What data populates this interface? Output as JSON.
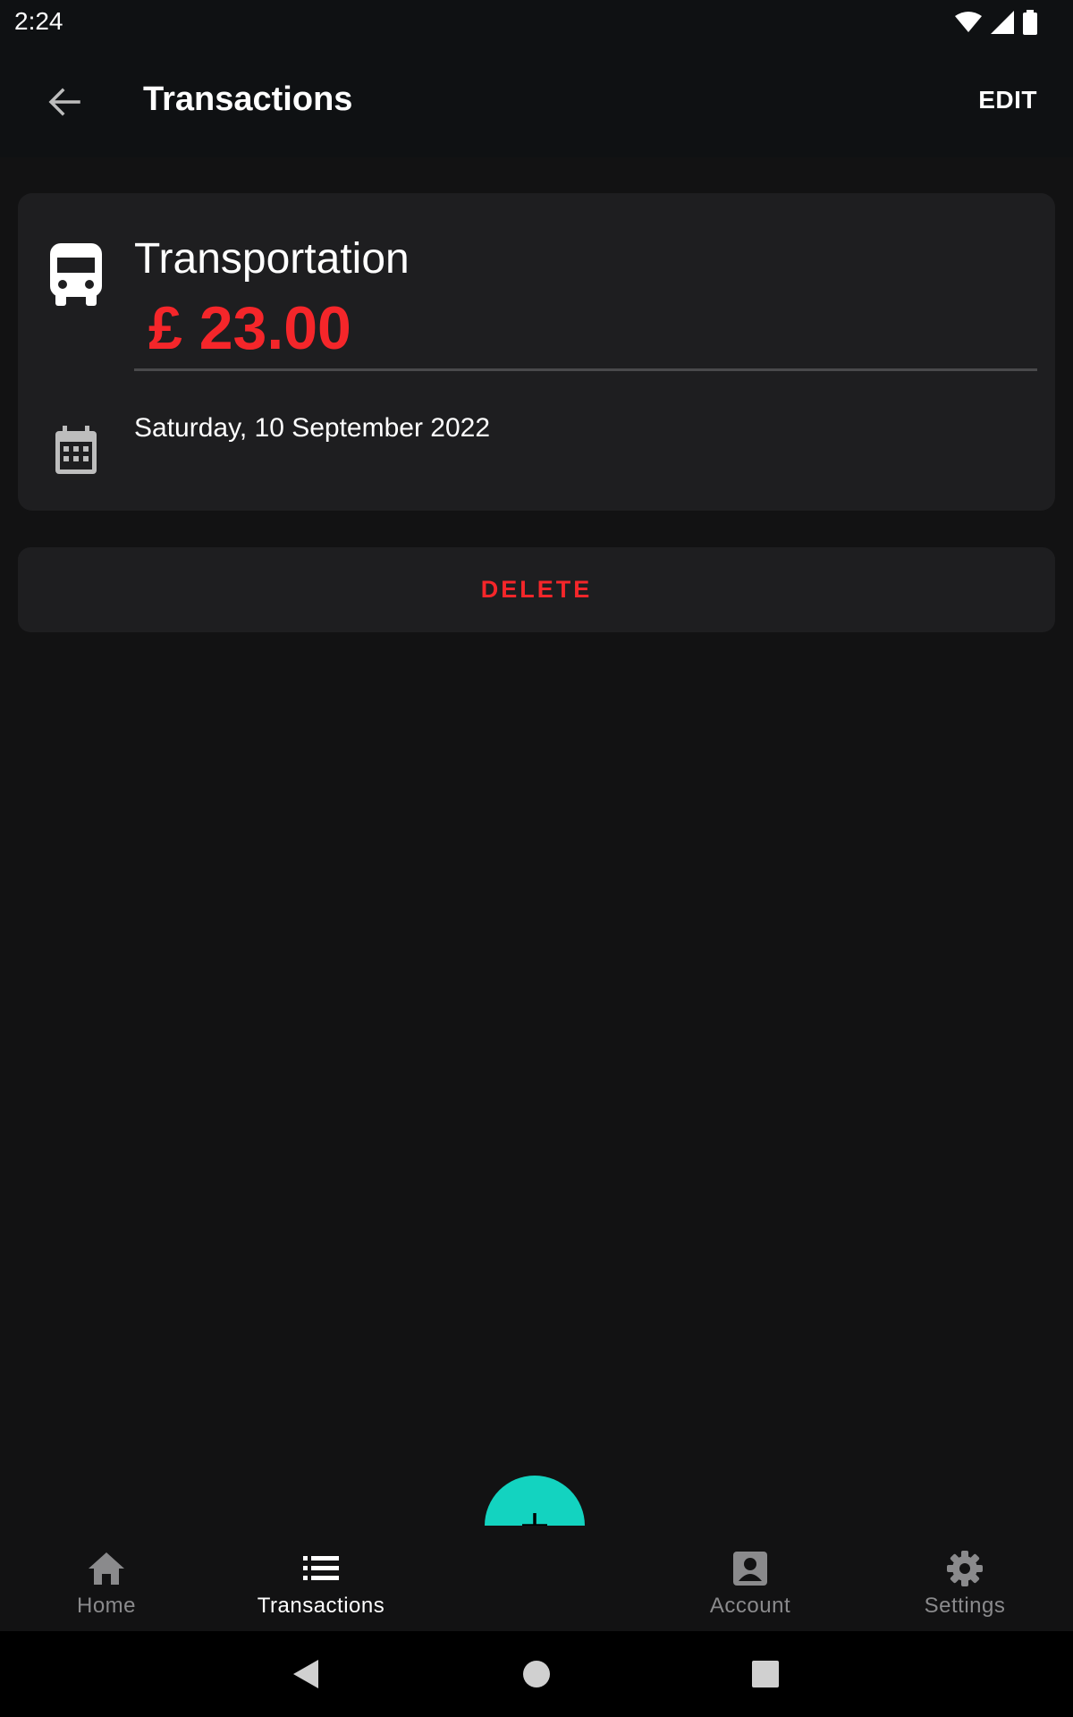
{
  "status_bar": {
    "time": "2:24",
    "icons": [
      "wifi-icon",
      "cellular-signal-icon",
      "battery-icon"
    ]
  },
  "app_bar": {
    "back_icon": "arrow-left-icon",
    "title": "Transactions",
    "edit_label": "EDIT"
  },
  "transaction": {
    "category_icon": "bus-icon",
    "category": "Transportation",
    "amount": "£ 23.00",
    "date_icon": "calendar-icon",
    "date": "Saturday, 10 September 2022"
  },
  "delete_label": "DELETE",
  "fab": {
    "icon": "plus-icon"
  },
  "bottom_nav": {
    "items": [
      {
        "label": "Home",
        "icon": "home-icon",
        "active": false
      },
      {
        "label": "Transactions",
        "icon": "list-icon",
        "active": true
      },
      {
        "label": "Account",
        "icon": "account-icon",
        "active": false
      },
      {
        "label": "Settings",
        "icon": "gear-icon",
        "active": false
      }
    ]
  },
  "system_nav": {
    "icons": [
      "back-triangle-icon",
      "home-circle-icon",
      "recents-square-icon"
    ]
  },
  "colors": {
    "background": "#121213",
    "app_bar": "#0f1113",
    "card": "#1e1e20",
    "expense_red": "#f5262a",
    "fab_teal": "#13d3c0",
    "inactive_nav": "#8a8a8c"
  }
}
